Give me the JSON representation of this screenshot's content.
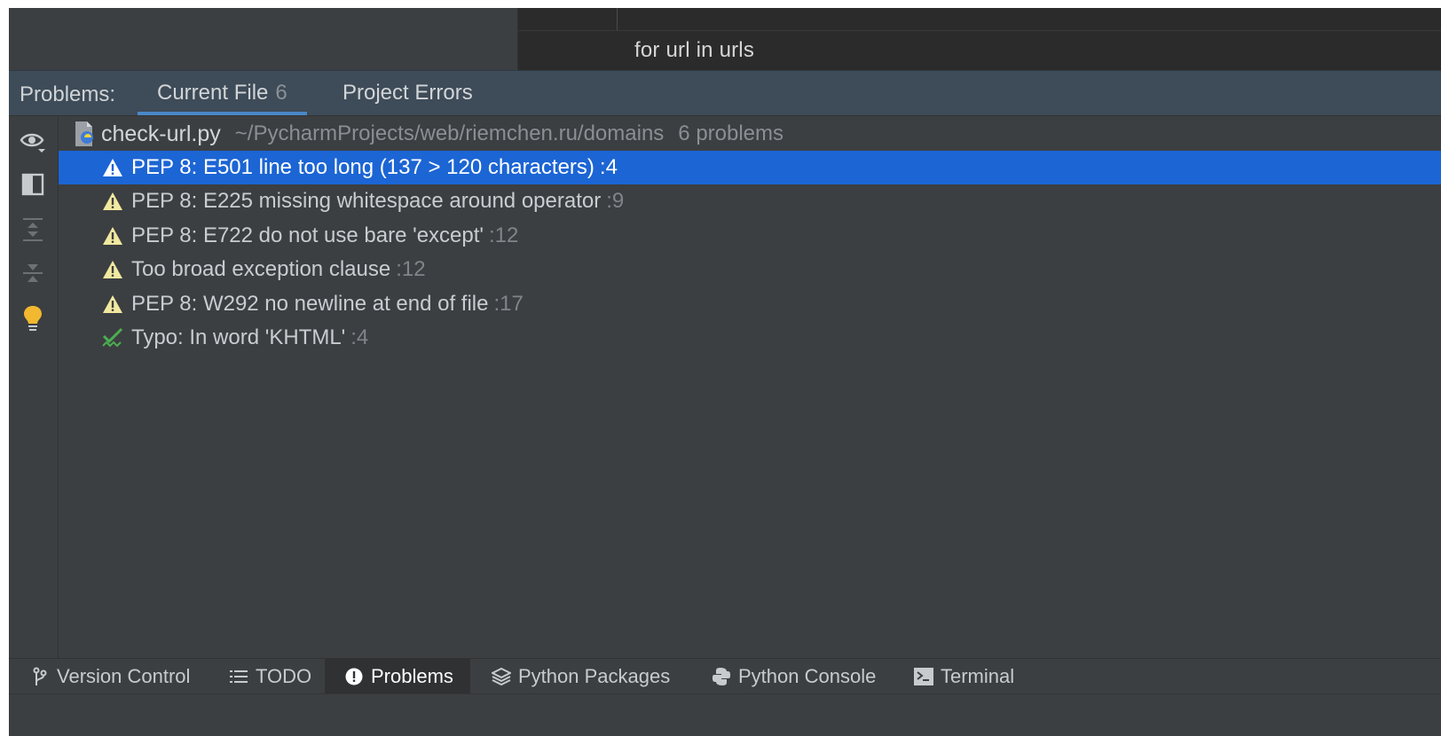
{
  "editor": {
    "code_line": "for url in urls"
  },
  "problems_panel": {
    "prefix": "Problems:",
    "tabs": [
      {
        "label": "Current File",
        "count": "6",
        "active": true
      },
      {
        "label": "Project Errors",
        "count": "",
        "active": false
      }
    ],
    "file": {
      "name": "check-url.py",
      "path": "~/PycharmProjects/web/riemchen.ru/domains",
      "count_text": "6 problems"
    },
    "items": [
      {
        "icon": "warning-icon",
        "message": "PEP 8: E501 line too long (137 > 120 characters)",
        "line": ":4",
        "selected": true
      },
      {
        "icon": "warning-icon",
        "message": "PEP 8: E225 missing whitespace around operator",
        "line": ":9",
        "selected": false
      },
      {
        "icon": "warning-icon",
        "message": "PEP 8: E722 do not use bare 'except'",
        "line": ":12",
        "selected": false
      },
      {
        "icon": "warning-icon",
        "message": "Too broad exception clause",
        "line": ":12",
        "selected": false
      },
      {
        "icon": "warning-icon",
        "message": "PEP 8: W292 no newline at end of file",
        "line": ":17",
        "selected": false
      },
      {
        "icon": "typo-icon",
        "message": "Typo: In word 'KHTML'",
        "line": ":4",
        "selected": false
      }
    ]
  },
  "toolbar_icons": [
    "eye-icon",
    "preview-icon",
    "expand-all-icon",
    "collapse-all-icon",
    "lightbulb-icon"
  ],
  "bottom_bar": {
    "tabs": [
      {
        "label": "Version Control",
        "icon": "branch-icon"
      },
      {
        "label": "TODO",
        "icon": "list-icon"
      },
      {
        "label": "Problems",
        "icon": "exclamation-icon",
        "active": true
      },
      {
        "label": "Python Packages",
        "icon": "layers-icon"
      },
      {
        "label": "Python Console",
        "icon": "python-icon"
      },
      {
        "label": "Terminal",
        "icon": "terminal-icon"
      }
    ]
  },
  "colors": {
    "selection": "#1c65d4",
    "warning": "#f2e9a0",
    "typo_check": "#4caf50",
    "lightbulb": "#f2b830",
    "tab_underline": "#4a88c7"
  }
}
